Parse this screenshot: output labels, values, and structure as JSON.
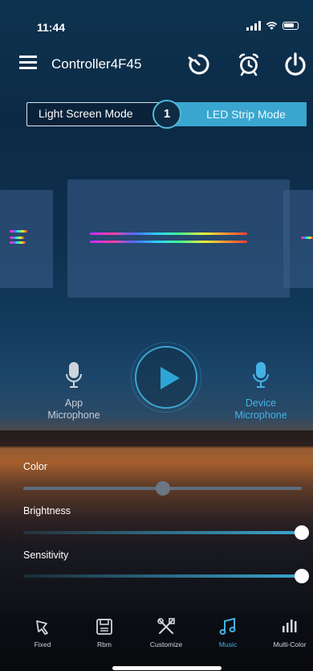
{
  "status_bar": {
    "time": "11:44"
  },
  "header": {
    "title": "Controller4F45",
    "icons": [
      "menu-icon",
      "timer-icon",
      "alarm-clock-icon",
      "power-icon"
    ]
  },
  "mode_switch": {
    "left_label": "Light Screen Mode",
    "right_label": "LED Strip Mode",
    "badge": "1",
    "selected": "LED Strip Mode"
  },
  "microphones": {
    "app": {
      "line1": "App",
      "line2": "Microphone"
    },
    "device": {
      "line1": "Device",
      "line2": "Microphone",
      "selected": true
    }
  },
  "sliders": {
    "color": {
      "label": "Color",
      "value": 0.5
    },
    "brightness": {
      "label": "Brightness",
      "value": 1.0
    },
    "sensitivity": {
      "label": "Sensitivity",
      "value": 1.0
    }
  },
  "tabs": [
    {
      "label": "Fixed",
      "icon": "pin-icon"
    },
    {
      "label": "Rbm",
      "icon": "save-icon"
    },
    {
      "label": "Customize",
      "icon": "tools-icon"
    },
    {
      "label": "Music",
      "icon": "music-note-icon",
      "active": true
    },
    {
      "label": "Multi-Color",
      "icon": "equalizer-icon"
    }
  ],
  "colors": {
    "accent": "#3aa6cf",
    "track_inactive": "#5d6d7d",
    "knob": "#ffffff"
  }
}
